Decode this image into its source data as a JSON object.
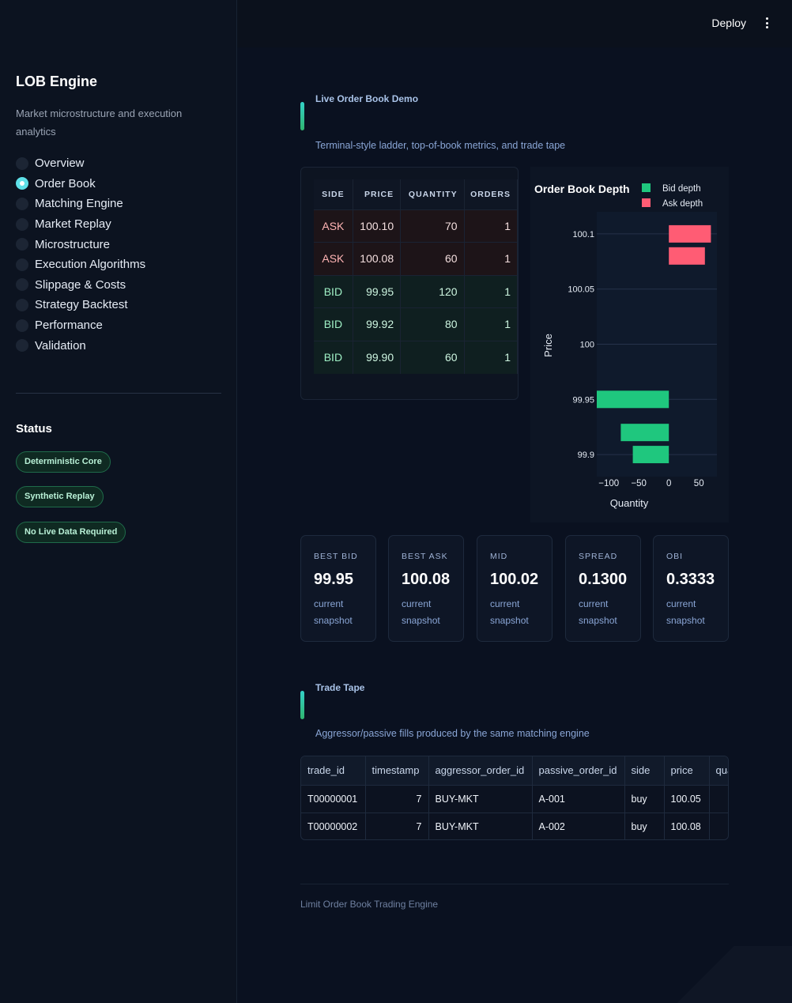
{
  "sidebar": {
    "title": "LOB Engine",
    "subtitle": "Market microstructure and execution analytics",
    "nav": [
      {
        "label": "Overview",
        "active": false
      },
      {
        "label": "Order Book",
        "active": true
      },
      {
        "label": "Matching Engine",
        "active": false
      },
      {
        "label": "Market Replay",
        "active": false
      },
      {
        "label": "Microstructure",
        "active": false
      },
      {
        "label": "Execution Algorithms",
        "active": false
      },
      {
        "label": "Slippage & Costs",
        "active": false
      },
      {
        "label": "Strategy Backtest",
        "active": false
      },
      {
        "label": "Performance",
        "active": false
      },
      {
        "label": "Validation",
        "active": false
      }
    ],
    "status_title": "Status",
    "badges": [
      "Deterministic Core",
      "Synthetic Replay",
      "No Live Data Required"
    ]
  },
  "header": {
    "deploy_label": "Deploy",
    "menu_icon": "kebab-menu-icon"
  },
  "order_book_section": {
    "title": "Live Order Book Demo",
    "description": "Terminal-style ladder, top-of-book metrics, and trade tape"
  },
  "ladder": {
    "columns": [
      "SIDE",
      "PRICE",
      "QUANTITY",
      "ORDERS"
    ],
    "rows": [
      {
        "side": "ASK",
        "price": "100.10",
        "quantity": "70",
        "orders": "1"
      },
      {
        "side": "ASK",
        "price": "100.08",
        "quantity": "60",
        "orders": "1"
      },
      {
        "side": "BID",
        "price": "99.95",
        "quantity": "120",
        "orders": "1"
      },
      {
        "side": "BID",
        "price": "99.92",
        "quantity": "80",
        "orders": "1"
      },
      {
        "side": "BID",
        "price": "99.90",
        "quantity": "60",
        "orders": "1"
      }
    ]
  },
  "chart_data": {
    "type": "bar",
    "orientation": "horizontal",
    "title": "Order Book Depth",
    "xlabel": "Quantity",
    "ylabel": "Price",
    "xlim": [
      -120,
      80
    ],
    "ylim": [
      99.88,
      100.12
    ],
    "x_ticks": [
      "−100",
      "−50",
      "0",
      "50"
    ],
    "x_tick_values": [
      -100,
      -50,
      0,
      50
    ],
    "y_ticks": [
      "100.1",
      "100.05",
      "100",
      "99.95",
      "99.9"
    ],
    "y_tick_values": [
      100.1,
      100.05,
      100.0,
      99.95,
      99.9
    ],
    "legend_placement": "top-right",
    "series": [
      {
        "name": "Bid depth",
        "color": "#1fc77e",
        "points": [
          {
            "price": 99.95,
            "quantity": -120
          },
          {
            "price": 99.92,
            "quantity": -80
          },
          {
            "price": 99.9,
            "quantity": -60
          }
        ]
      },
      {
        "name": "Ask depth",
        "color": "#ff5c74",
        "points": [
          {
            "price": 100.1,
            "quantity": 70
          },
          {
            "price": 100.08,
            "quantity": 60
          }
        ]
      }
    ]
  },
  "metrics": [
    {
      "label": "BEST BID",
      "value": "99.95",
      "note": "current snapshot"
    },
    {
      "label": "BEST ASK",
      "value": "100.08",
      "note": "current snapshot"
    },
    {
      "label": "MID",
      "value": "100.02",
      "note": "current snapshot"
    },
    {
      "label": "SPREAD",
      "value": "0.1300",
      "note": "current snapshot"
    },
    {
      "label": "OBI",
      "value": "0.3333",
      "note": "current snapshot"
    }
  ],
  "trade_tape_section": {
    "title": "Trade Tape",
    "description": "Aggressor/passive fills produced by the same matching engine"
  },
  "trade_tape": {
    "columns": [
      "trade_id",
      "timestamp",
      "aggressor_order_id",
      "passive_order_id",
      "side",
      "price",
      "qua"
    ],
    "rows": [
      [
        "T00000001",
        "7",
        "BUY-MKT",
        "A-001",
        "buy",
        "100.05",
        ""
      ],
      [
        "T00000002",
        "7",
        "BUY-MKT",
        "A-002",
        "buy",
        "100.08",
        ""
      ]
    ]
  },
  "footer": {
    "text": "Limit Order Book Trading Engine"
  }
}
